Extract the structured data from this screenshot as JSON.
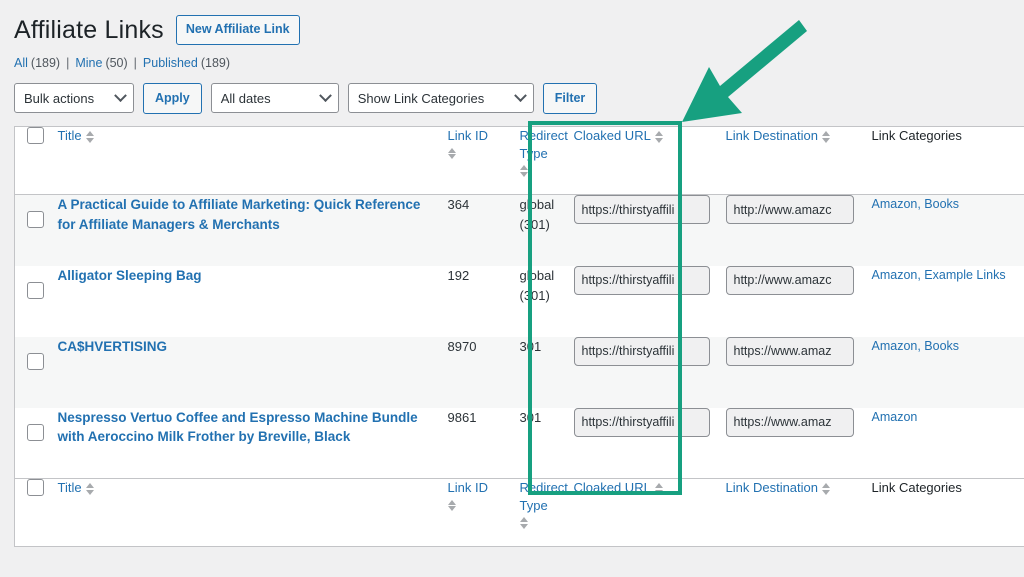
{
  "header": {
    "title": "Affiliate Links",
    "new_link_button": "New Affiliate Link"
  },
  "status_filters": [
    {
      "label": "All",
      "count": "(189)"
    },
    {
      "label": "Mine",
      "count": "(50)"
    },
    {
      "label": "Published",
      "count": "(189)"
    }
  ],
  "separator": "|",
  "toolbar": {
    "bulk_actions": "Bulk actions",
    "apply_label": "Apply",
    "all_dates": "All dates",
    "show_link_categories": "Show Link Categories",
    "filter_label": "Filter"
  },
  "table": {
    "columns": {
      "title": "Title",
      "link_id": "Link ID",
      "redirect_type_line1": "Redirect",
      "redirect_type_line2": "Type",
      "cloaked_url": "Cloaked URL",
      "link_destination": "Link Destination",
      "link_categories": "Link Categories"
    },
    "rows": [
      {
        "title": "A Practical Guide to Affiliate Marketing: Quick Reference for Affiliate Managers & Merchants",
        "link_id": "364",
        "redirect_type_line1": "global",
        "redirect_type_line2": "(301)",
        "cloaked_url": "https://thirstyaffili",
        "link_destination": "http://www.amazc",
        "link_categories": "Amazon, Books"
      },
      {
        "title": "Alligator Sleeping Bag",
        "link_id": "192",
        "redirect_type_line1": "global",
        "redirect_type_line2": "(301)",
        "cloaked_url": "https://thirstyaffili",
        "link_destination": "http://www.amazc",
        "link_categories": "Amazon, Example Links"
      },
      {
        "title": "CA$HVERTISING",
        "link_id": "8970",
        "redirect_type_line1": "301",
        "redirect_type_line2": "",
        "cloaked_url": "https://thirstyaffili",
        "link_destination": "https://www.amaz",
        "link_categories": "Amazon, Books"
      },
      {
        "title": "Nespresso Vertuo Coffee and Espresso Machine Bundle with Aeroccino Milk Frother by Breville, Black",
        "link_id": "9861",
        "redirect_type_line1": "301",
        "redirect_type_line2": "",
        "cloaked_url": "https://thirstyaffili",
        "link_destination": "https://www.amaz",
        "link_categories": "Amazon"
      }
    ]
  },
  "annotation": {
    "highlight_color": "#17a080",
    "arrow_color": "#17a080",
    "target_column": "Cloaked URL"
  }
}
